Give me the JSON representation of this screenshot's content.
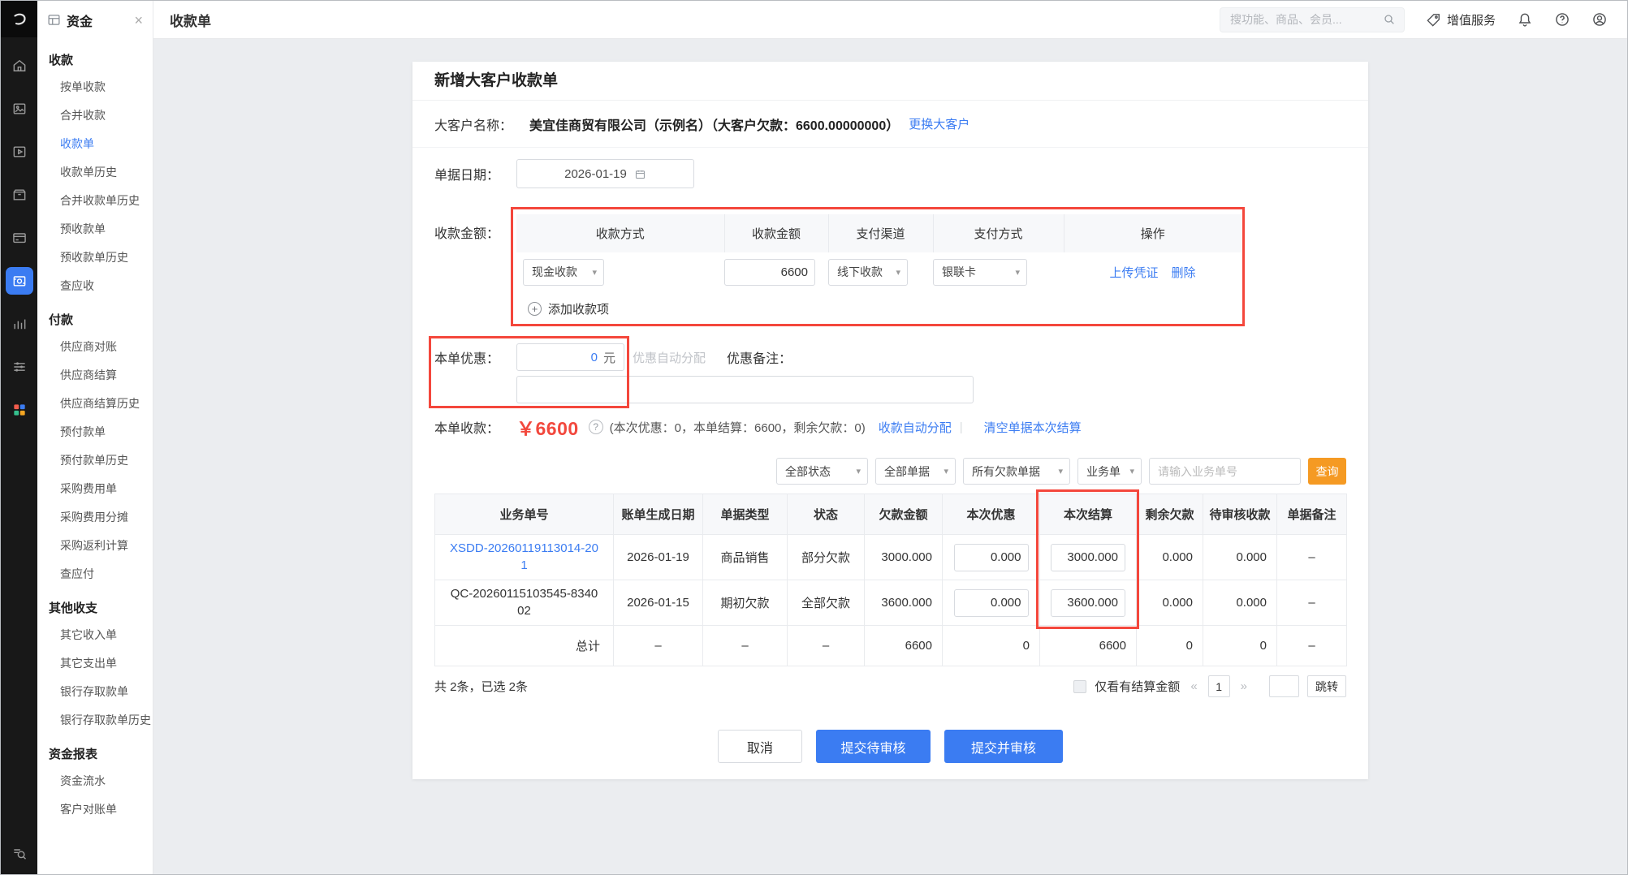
{
  "colors": {
    "accent_blue": "#3B7CF2",
    "price_red": "#F2483D",
    "annotation_red": "#F4473C",
    "search_orange": "#F59A23",
    "rail_dark": "#181818",
    "page_background": "#EBEDF0"
  },
  "glyphs": {
    "close": "×",
    "caret": "▾",
    "plus": "+",
    "info": "?",
    "sep": "|"
  },
  "rail": {
    "icons": [
      "home",
      "gallery",
      "video",
      "package",
      "billing",
      "funds",
      "reports",
      "settings",
      "apps"
    ],
    "active_icon": "funds",
    "bottom_icon": "list-search"
  },
  "topbar": {
    "page_title": "收款单",
    "search_placeholder": "搜功能、商品、会员...",
    "vas_label": "增值服务"
  },
  "sidebar": {
    "title": "资金",
    "sections": [
      {
        "title": "收款",
        "items": [
          {
            "label": "按单收款"
          },
          {
            "label": "合并收款"
          },
          {
            "label": "收款单",
            "active": true
          },
          {
            "label": "收款单历史"
          },
          {
            "label": "合并收款单历史"
          },
          {
            "label": "预收款单"
          },
          {
            "label": "预收款单历史"
          },
          {
            "label": "查应收"
          }
        ]
      },
      {
        "title": "付款",
        "items": [
          {
            "label": "供应商对账"
          },
          {
            "label": "供应商结算"
          },
          {
            "label": "供应商结算历史"
          },
          {
            "label": "预付款单"
          },
          {
            "label": "预付款单历史"
          },
          {
            "label": "采购费用单"
          },
          {
            "label": "采购费用分摊"
          },
          {
            "label": "采购返利计算"
          },
          {
            "label": "查应付"
          }
        ]
      },
      {
        "title": "其他收支",
        "items": [
          {
            "label": "其它收入单"
          },
          {
            "label": "其它支出单"
          },
          {
            "label": "银行存取款单"
          },
          {
            "label": "银行存取款单历史"
          }
        ]
      },
      {
        "title": "资金报表",
        "items": [
          {
            "label": "资金流水"
          },
          {
            "label": "客户对账单"
          }
        ]
      }
    ]
  },
  "form": {
    "title": "新增大客户收款单",
    "customer": {
      "label": "大客户名称：",
      "value": "美宜佳商贸有限公司（示例名）（大客户欠款：6600.00000000）",
      "change_link": "更换大客户"
    },
    "date": {
      "label": "单据日期：",
      "value": "2026-01-19"
    },
    "amount": {
      "label": "收款金额：",
      "headers": [
        "收款方式",
        "收款金额",
        "支付渠道",
        "支付方式",
        "操作"
      ],
      "row": {
        "method": "现金收款",
        "amount": "6600",
        "channel": "线下收款",
        "pay_type": "银联卡",
        "upload_link": "上传凭证",
        "delete_link": "删除"
      },
      "add_label": "添加收款项"
    },
    "discount": {
      "label": "本单优惠：",
      "value": "0",
      "unit": "元",
      "auto_text": "优惠自动分配",
      "note_label": "优惠备注："
    },
    "receipt": {
      "label": "本单收款：",
      "amount": "￥6600",
      "detail": "(本次优惠：0，本单结算：6600，剩余欠款：0)",
      "auto_link": "收款自动分配",
      "clear_link": "清空单据本次结算"
    }
  },
  "filters": {
    "status": "全部状态",
    "doc_type": "全部单据",
    "debt_type": "所有欠款单据",
    "biz_type": "业务单",
    "input_placeholder": "请输入业务单号",
    "search_button": "查询"
  },
  "table": {
    "headers": [
      "业务单号",
      "账单生成日期",
      "单据类型",
      "状态",
      "欠款金额",
      "本次优惠",
      "本次结算",
      "剩余欠款",
      "待审核收款",
      "单据备注"
    ],
    "rows": [
      {
        "order_no": "XSDD-20260119113014-201",
        "date": "2026-01-19",
        "doc_type": "商品销售",
        "status": "部分欠款",
        "debt": "3000.000",
        "discount": "0.000",
        "settle": "3000.000",
        "remaining": "0.000",
        "pending": "0.000",
        "note": "–"
      },
      {
        "order_no": "QC-20260115103545-834002",
        "date": "2026-01-15",
        "doc_type": "期初欠款",
        "status": "全部欠款",
        "debt": "3600.000",
        "discount": "0.000",
        "settle": "3600.000",
        "remaining": "0.000",
        "pending": "0.000",
        "note": "–"
      }
    ],
    "total": {
      "label": "总计",
      "date": "–",
      "doc_type": "–",
      "status": "–",
      "debt": "6600",
      "discount": "0",
      "settle": "6600",
      "remaining": "0",
      "pending": "0",
      "note": "–"
    }
  },
  "pagination": {
    "count_text": "共 2条，已选 2条",
    "checkbox_label": "仅看有结算金额",
    "prev": "«",
    "page": "1",
    "next": "»",
    "jump_label": "跳转"
  },
  "actions": {
    "cancel": "取消",
    "submit_review": "提交待审核",
    "submit_audit": "提交并审核"
  }
}
